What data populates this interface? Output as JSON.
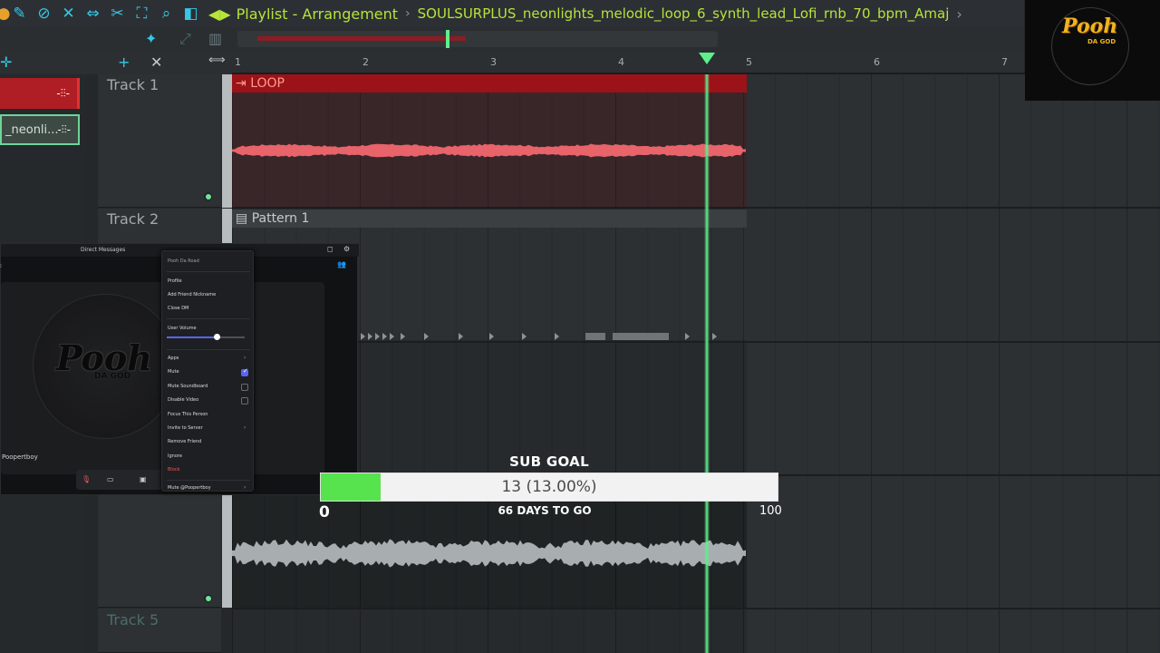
{
  "toolbar": {
    "icons": [
      "snap-icon",
      "paint-icon",
      "delete-icon",
      "mute-icon",
      "slip-icon",
      "slice-icon",
      "select-icon",
      "zoom-icon",
      "playback-icon"
    ],
    "playlist_title": "Playlist - Arrangement",
    "file_name": "SOULSURPLUS_neonlights_melodic_loop_6_synth_lead_Lofi_rnb_70_bpm_Amaj",
    "breadcrumb_end": "›"
  },
  "ruler": {
    "bars": [
      "1",
      "2",
      "3",
      "4",
      "5",
      "6",
      "7"
    ]
  },
  "clips": {
    "loop_clip": "",
    "neon_clip": "_neonli..."
  },
  "tracks": [
    {
      "name": "Track 1"
    },
    {
      "name": "Track 2"
    },
    {
      "name": "Track 5"
    }
  ],
  "arrangement": {
    "loop_label": "LOOP",
    "pattern_label": "Pattern 1"
  },
  "discord": {
    "title": "Direct Messages",
    "logo_text": "Pooh",
    "logo_sub": "DA GOD",
    "user": "Poopertboy",
    "context_menu": {
      "header": "Pooh Da Road",
      "items": [
        {
          "label": "Profile"
        },
        {
          "label": "Add Friend Nickname"
        },
        {
          "label": "Close DM"
        },
        {
          "label": "User Volume"
        },
        {
          "label": "Apps"
        },
        {
          "label": "Mute"
        },
        {
          "label": "Mute Soundboard"
        },
        {
          "label": "Disable Video"
        },
        {
          "label": "Focus This Person"
        },
        {
          "label": "Invite to Server"
        },
        {
          "label": "Remove Friend"
        },
        {
          "label": "Ignore"
        },
        {
          "label": "Block"
        },
        {
          "label": "Mute @Poopertboy"
        }
      ],
      "user_volume": 0.64
    }
  },
  "sub_goal": {
    "title": "SUB GOAL",
    "progress_text": "13 (13.00%)",
    "progress": 0.13,
    "min": "0",
    "max": "100",
    "days_left": "66 DAYS TO GO"
  },
  "stream_logo": {
    "text": "Pooh",
    "sub": "DA GOD"
  },
  "colors": {
    "accent": "#b7e43a",
    "icon": "#35c8e6",
    "playhead": "#5ef08c",
    "loop_clip": "#9c1219",
    "loop_wave": "#e8636a",
    "audio_wave": "#a8adb0",
    "goal_fill": "#57e34e"
  }
}
